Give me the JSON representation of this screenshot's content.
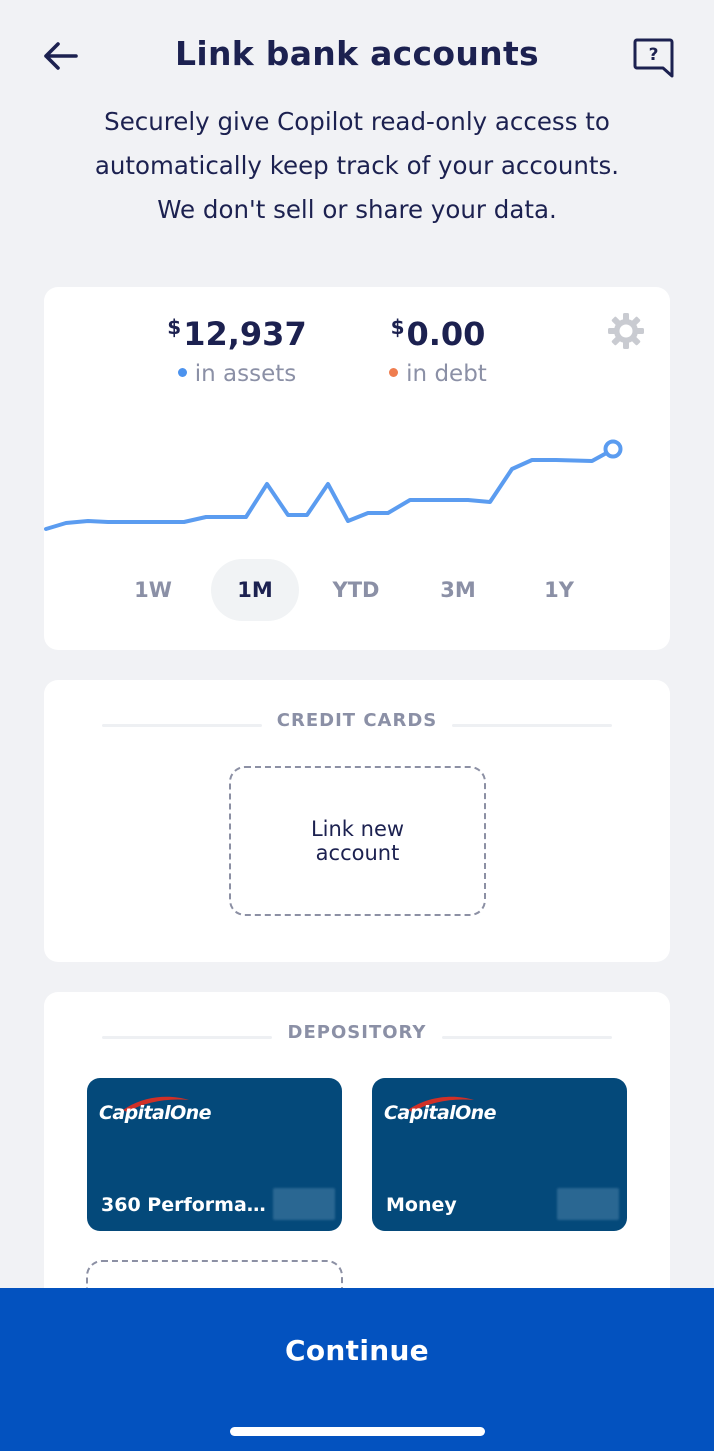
{
  "header": {
    "title": "Link bank accounts",
    "back_icon": "arrow-left-icon",
    "help_icon": "chat-question-icon",
    "help_glyph": "?",
    "subtitle_lines": [
      "Securely give Copilot read-only access to",
      "automatically keep track of your accounts.",
      "We don't sell or share your data."
    ]
  },
  "summary": {
    "assets": {
      "currency": "$",
      "value": "12,937",
      "label": "in assets",
      "dot_color": "#4c93ee"
    },
    "debt": {
      "currency": "$",
      "value": "0.00",
      "label": "in debt",
      "dot_color": "#ef7d4f"
    },
    "settings_icon": "gear-icon",
    "line_color": "#5b9cf0",
    "ranges": [
      "1W",
      "1M",
      "YTD",
      "3M",
      "1Y"
    ],
    "selected_range": "1M"
  },
  "credit_cards": {
    "heading": "CREDIT CARDS",
    "link_new_label": "Link new account"
  },
  "depository": {
    "heading": "DEPOSITORY",
    "accounts": [
      {
        "bank": "Capital One",
        "logo_text": "CapitalOne",
        "name": "360 Performanc…"
      },
      {
        "bank": "Capital One",
        "logo_text": "CapitalOne",
        "name": "Money"
      }
    ],
    "card_color": "#04497a"
  },
  "footer": {
    "continue_label": "Continue",
    "color": "#0352bf"
  }
}
